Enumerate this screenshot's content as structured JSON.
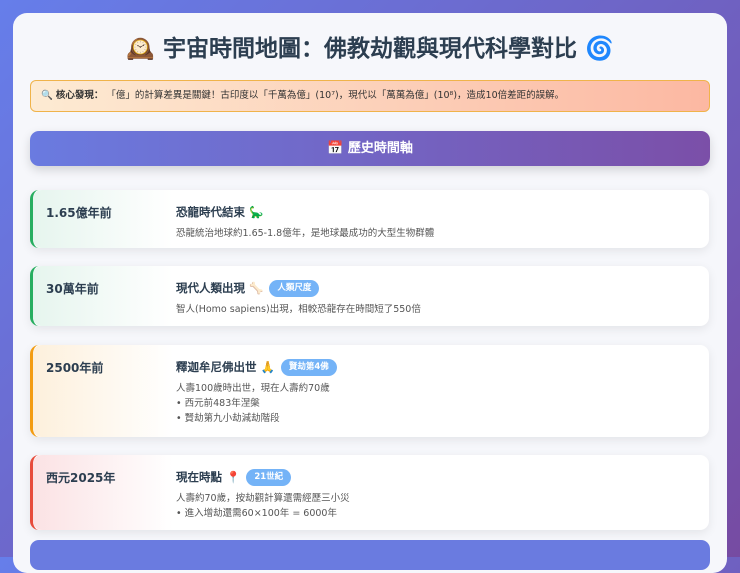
{
  "title": "🕰️ 宇宙時間地圖：佛教劫觀與現代科學對比 🌀",
  "alert": {
    "icon": "🔍",
    "label": "核心發現：",
    "text": "「億」的計算差異是關鍵！古印度以「千萬為億」(10⁷)，現代以「萬萬為億」(10⁸)，造成10倍差距的誤解。"
  },
  "section": {
    "icon": "📅",
    "label": "歷史時間軸"
  },
  "events": [
    {
      "date": "1.65億年前",
      "title": "恐龍時代結束 🦕",
      "badge": null,
      "lines": [
        "恐龍統治地球約1.65-1.8億年，是地球最成功的大型生物群體"
      ],
      "color": "#27ae60"
    },
    {
      "date": "30萬年前",
      "title": "現代人類出現 🦴",
      "badge": "人類尺度",
      "lines": [
        "智人(Homo sapiens)出現，相較恐龍存在時間短了550倍"
      ],
      "color": "#27ae60"
    },
    {
      "date": "2500年前",
      "title": "釋迦牟尼佛出世 🙏",
      "badge": "賢劫第4佛",
      "lines": [
        "人壽100歲時出世，現在人壽約70歲",
        "• 西元前483年涅槃",
        "• 賢劫第九小劫減劫階段"
      ],
      "color": "#f39c12"
    },
    {
      "date": "西元2025年",
      "title": "現在時點 📍",
      "badge": "21世紀",
      "lines": [
        "人壽約70歲，按劫觀計算還需經歷三小災",
        "• 進入增劫還需60×100年 = 6000年"
      ],
      "color": "#e74c3c"
    }
  ]
}
